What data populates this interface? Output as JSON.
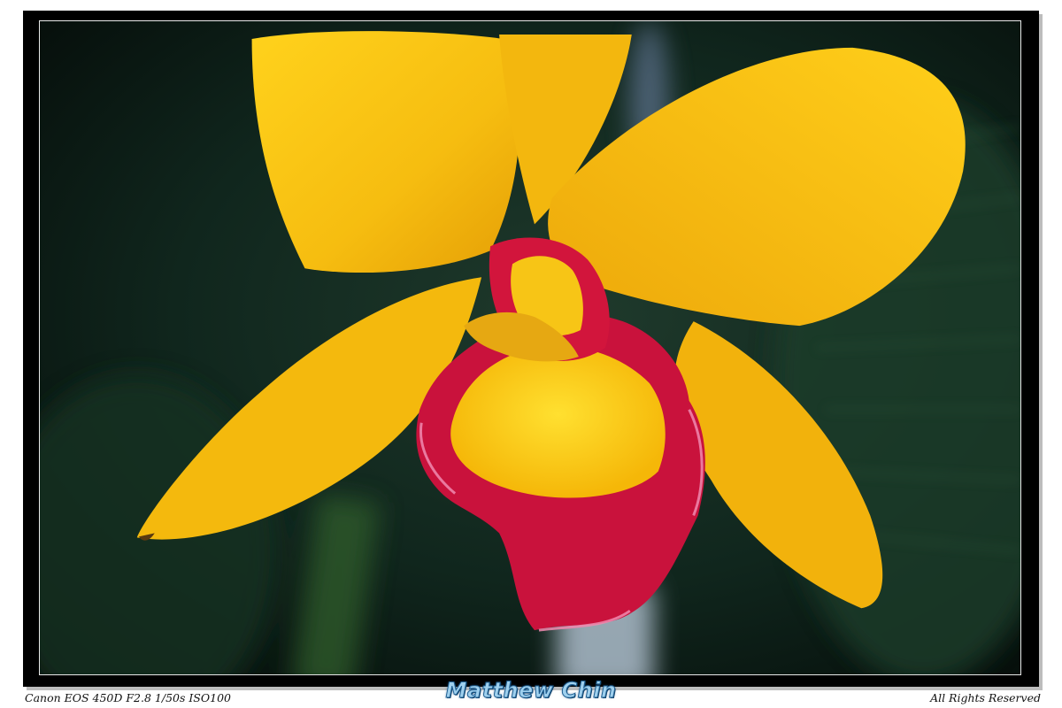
{
  "photo": {
    "subject_icon": "orchid-photo",
    "colors": {
      "petal": "#f5bd12",
      "lip_red": "#c6123a",
      "background": "#0d231a"
    }
  },
  "captions": {
    "camera_info": "Canon EOS 450D F2.8 1/50s ISO100",
    "photographer": "Matthew Chin",
    "rights": "All Rights Reserved"
  }
}
